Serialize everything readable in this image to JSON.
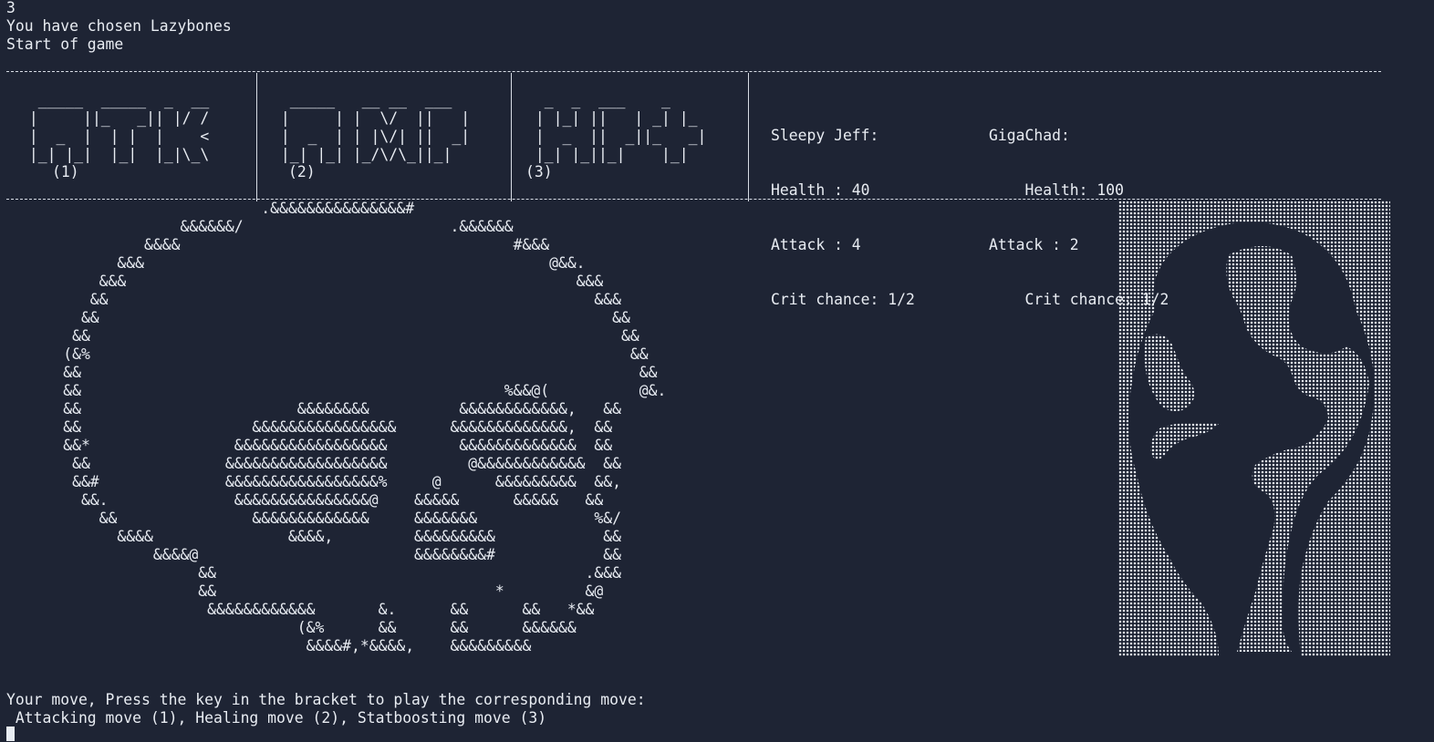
{
  "console": {
    "input_echo": "3",
    "chosen_line": "You have chosen Lazybones",
    "start_line": "Start of game"
  },
  "moves": {
    "atk": {
      "art": "  _____  _____  _  __\n |     ||_   _|| |/ /\n |  _  |  | |  |    <\n |_| |_|  |_|  |_|\\_\\",
      "key": "(1)"
    },
    "amp": {
      "art": "  _____   __ __  ___\n |     | |  \\/  ||   |\n |  _  | | |\\/| ||  _|\n |_| |_| |_/\\/\\_||_|",
      "key": "(2)"
    },
    "hp": {
      "art": "  _  _  ___    _\n | |_| ||   | _| |_\n |  _  ||  _||_   _|\n |_| |_||_|    |_|",
      "key": "(3)"
    }
  },
  "player": {
    "name": "Sleepy Jeff:",
    "health": "Health : 40",
    "attack": "Attack : 4",
    "crit": "Crit chance: 1/2"
  },
  "enemy": {
    "name": "GigaChad:",
    "health": "    Health: 100",
    "attack": "Attack : 2",
    "crit": "    Crit chance: 1/2"
  },
  "scene": {
    "ascii_art": "                            .&&&&&&&&&&&&&&&#\n                   &&&&&&/                       .&&&&&&\n               &&&&                                     #&&&\n            &&&                                             @&&.\n          &&&                                                  &&&\n         &&                                                      &&&\n        &&                                                         &&\n       &&                                                           &&\n      (&%                                                            &&\n      &&                                                              &&\n      &&                                               %&&@(          @&.\n      &&                        &&&&&&&&          &&&&&&&&&&&&,   &&\n      &&                   &&&&&&&&&&&&&&&&      &&&&&&&&&&&&&,  &&\n      &&*                &&&&&&&&&&&&&&&&&        &&&&&&&&&&&&&  &&\n       &&               &&&&&&&&&&&&&&&&&&         @&&&&&&&&&&&&  &&\n       &&#              &&&&&&&&&&&&&&&&&%     @      &&&&&&&&&  &&,\n        &&.              &&&&&&&&&&&&&&&@    &&&&&      &&&&&   &&\n          &&               &&&&&&&&&&&&&     &&&&&&&             %&/\n            &&&&               &&&&,         &&&&&&&&&            &&\n                &&&&@                        &&&&&&&&#            &&\n                     &&                                         .&&&\n                     &&                               *         &@\n                      &&&&&&&&&&&&       &.      &&      &&   *&&\n                                (&%      &&      &&      &&&&&&\n                                 &&&&#,*&&&&,    &&&&&&&&&"
  },
  "prompt": {
    "line1": "Your move, Press the key in the bracket to play the corresponding move:",
    "line2": " Attacking move (1), Healing move (2), Statboosting move (3)"
  },
  "colors": {
    "background": "#1e2434",
    "text": "#e8ecf2"
  },
  "icons": {
    "portrait": "gigachad-dot-portrait",
    "cursor": "terminal-block-cursor"
  }
}
